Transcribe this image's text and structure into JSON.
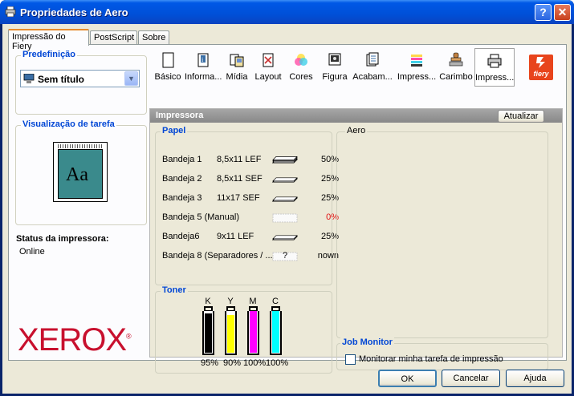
{
  "window": {
    "title": "Propriedades de Aero",
    "help_label": "?",
    "close_label": "✕"
  },
  "tabs": [
    "Impressão do Fiery",
    "PostScript",
    "Sobre"
  ],
  "preset": {
    "title": "Predefinição",
    "value": "Sem título"
  },
  "job_preview": {
    "title": "Visualização de tarefa",
    "thumb_text": "Aa"
  },
  "printer_status": {
    "label": "Status da impressora:",
    "value": "Online"
  },
  "brand": {
    "logo": "XEROX",
    "mark": "®"
  },
  "toolbar": [
    {
      "label": "Básico",
      "icon": "document-icon"
    },
    {
      "label": "Informa...",
      "icon": "info-icon"
    },
    {
      "label": "Mídia",
      "icon": "media-icon"
    },
    {
      "label": "Layout",
      "icon": "layout-icon"
    },
    {
      "label": "Cores",
      "icon": "color-wheel-icon"
    },
    {
      "label": "Figura",
      "icon": "image-icon"
    },
    {
      "label": "Acabam...",
      "icon": "finishing-icon"
    },
    {
      "label": "Impress...",
      "icon": "print-quality-icon"
    },
    {
      "label": "Carimbo",
      "icon": "stamp-icon"
    },
    {
      "label": "Impress...",
      "icon": "printer-icon",
      "active": true
    }
  ],
  "fiery_logo": "fiery",
  "printer_panel": {
    "header": "Impressora",
    "update_button": "Atualizar",
    "paper": {
      "title": "Papel",
      "trays": [
        {
          "name": "Bandeja 1",
          "size": "8,5x11 LEF",
          "level": "50%",
          "fill": 0.5
        },
        {
          "name": "Bandeja 2",
          "size": "8,5x11 SEF",
          "level": "25%",
          "fill": 0.25
        },
        {
          "name": "Bandeja 3",
          "size": "11x17 SEF",
          "level": "25%",
          "fill": 0.25
        },
        {
          "name": "Bandeja 5 (Manual)",
          "size": "",
          "level": "0%",
          "fill": 0,
          "warning": true
        },
        {
          "name": "Bandeja6",
          "size": "9x11 LEF",
          "level": "25%",
          "fill": 0.25
        },
        {
          "name": "Bandeja 8 (Separadores / ...",
          "size": "",
          "level": "nown",
          "fill": 0,
          "unknown": true,
          "unknown_mark": "?"
        }
      ]
    },
    "aero": {
      "title": "Aero"
    },
    "toner": {
      "title": "Toner",
      "cartridges": [
        {
          "letter": "K",
          "value": "95%",
          "fill": 0.95,
          "color": "#000000"
        },
        {
          "letter": "Y",
          "value": "90%",
          "fill": 0.9,
          "color": "#ffff00"
        },
        {
          "letter": "M",
          "value": "100%",
          "fill": 1.0,
          "color": "#ff00ff"
        },
        {
          "letter": "C",
          "value": "100%",
          "fill": 1.0,
          "color": "#00ffff"
        }
      ]
    },
    "job_monitor": {
      "title": "Job Monitor",
      "checkbox_label": "Monitorar minha tarefa de impressão",
      "checked": false
    }
  },
  "buttons": {
    "ok": "OK",
    "cancel": "Cancelar",
    "help": "Ajuda"
  }
}
